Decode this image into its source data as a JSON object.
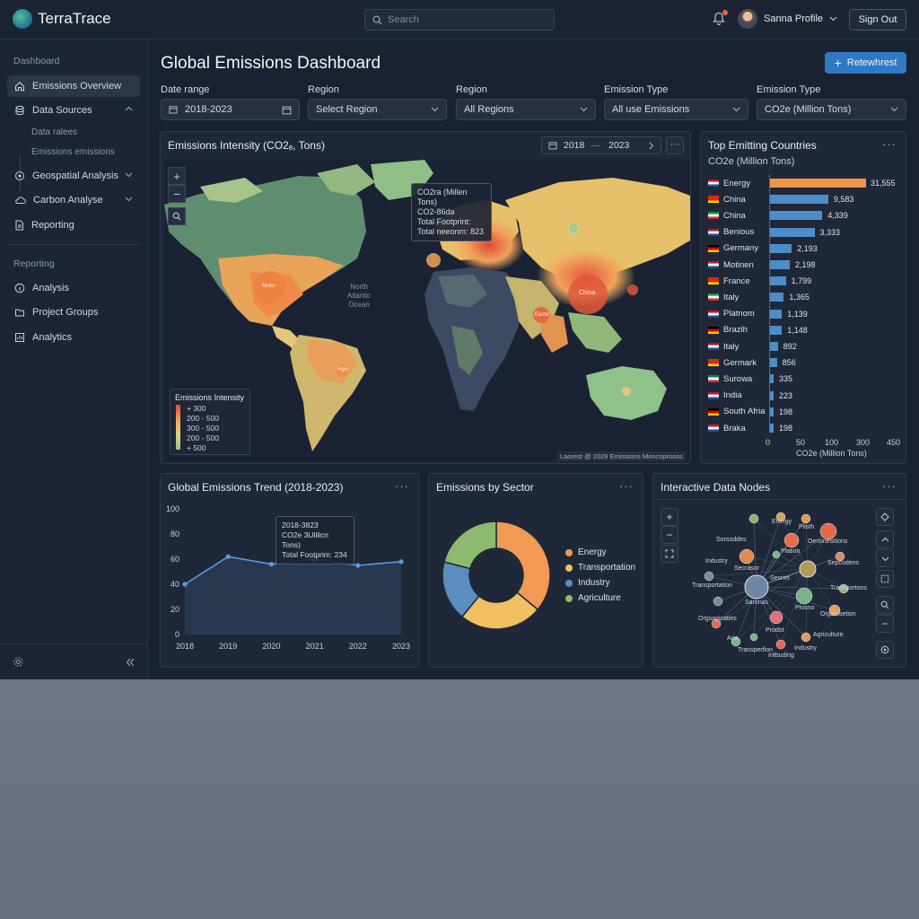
{
  "app": {
    "name": "TerraTrace"
  },
  "topbar": {
    "search_placeholder": "Search",
    "user_name": "Sanna Profile",
    "signout": "Sign Out"
  },
  "sidebar": {
    "section_dashboard": "Dashboard",
    "items": [
      {
        "label": "Emissions Overview",
        "icon": "home-icon"
      },
      {
        "label": "Data Sources",
        "icon": "database-icon"
      },
      {
        "label": "Geospatial Analysis",
        "icon": "map-pin-icon"
      },
      {
        "label": "Carbon Analyse",
        "icon": "cloud-icon"
      },
      {
        "label": "Reporting",
        "icon": "document-icon"
      }
    ],
    "subitems": [
      "Data ralees",
      "Emissions emissions"
    ],
    "section_reporting": "Reporting",
    "items2": [
      {
        "label": "Analysis",
        "icon": "info-icon"
      },
      {
        "label": "Project Groups",
        "icon": "folder-icon"
      },
      {
        "label": "Analytics",
        "icon": "analytics-icon"
      }
    ]
  },
  "main": {
    "title": "Global Emissions Dashboard",
    "refresh_label": "Retewhrest",
    "filters": [
      {
        "label": "Date range",
        "value": "2018-2023"
      },
      {
        "label": "Region",
        "value": "Select Region"
      },
      {
        "label": "Region",
        "value": "All Regions"
      },
      {
        "label": "Emission Type",
        "value": "All use Emissions"
      },
      {
        "label": "Emission Type",
        "value": "CO2e (Million Tons)"
      }
    ]
  },
  "map_panel": {
    "title": "Emissions Intensity (CO2ₑ, Tons)",
    "date_from": "2018",
    "date_sep": "—",
    "date_to": "2023",
    "tooltip": [
      "CO2ra (Millen Tons)",
      "CO2-86da",
      "Total Footprint:",
      "Total neeonm: 823"
    ],
    "ocean_label": [
      "North",
      "Atlantic",
      "Ocean"
    ],
    "bubble_labels": [
      "Moer",
      "China",
      "Easte",
      "Rgis"
    ],
    "legend_title": "Emissions Intensity",
    "legend_rows": [
      "+ 300",
      "200 - 500",
      "300 - 500",
      "200 - 500",
      "+ 500"
    ],
    "credit": "Laorest @ 2029 Emissions Moncoprooss",
    "colors": {
      "high": "#e2483c",
      "mid": "#f0a25a",
      "low": "#e6d37a",
      "min": "#8fc18b"
    }
  },
  "countries_panel": {
    "title": "Top Emitting Countries",
    "subtitle": "CO2e (Million Tons)",
    "xaxis_label": "CO2e (Million Tons)",
    "xticks": [
      "0",
      "50",
      "100",
      "300",
      "450"
    ],
    "rows": [
      {
        "name": "Energy",
        "value": "31,555",
        "pct": 0.97
      },
      {
        "name": "China",
        "value": "9,583",
        "pct": 0.59
      },
      {
        "name": "China",
        "value": "4,339",
        "pct": 0.53
      },
      {
        "name": "Benious",
        "value": "3,333",
        "pct": 0.45
      },
      {
        "name": "Germany",
        "value": "2,193",
        "pct": 0.22
      },
      {
        "name": "Motinen",
        "value": "2,198",
        "pct": 0.2
      },
      {
        "name": "France",
        "value": "1,799",
        "pct": 0.16
      },
      {
        "name": "Italy",
        "value": "1,365",
        "pct": 0.14
      },
      {
        "name": "Platnom",
        "value": "1,139",
        "pct": 0.12
      },
      {
        "name": "Brazih",
        "value": "1,148",
        "pct": 0.12
      },
      {
        "name": "Italy",
        "value": "892",
        "pct": 0.08
      },
      {
        "name": "Germark",
        "value": "856",
        "pct": 0.07
      },
      {
        "name": "Surowa",
        "value": "335",
        "pct": 0.03
      },
      {
        "name": "India",
        "value": "223",
        "pct": 0.02
      },
      {
        "name": "South Afria",
        "value": "198",
        "pct": 0.02
      },
      {
        "name": "Braka",
        "value": "198",
        "pct": 0.02
      }
    ]
  },
  "trend_panel": {
    "title": "Global Emissions Trend (2018-2023)",
    "tooltip": [
      "2018-3823",
      "CO2e 3Ulilicn Tons)",
      "Total Footprim: 234"
    ]
  },
  "sector_panel": {
    "title": "Emissions by Sector"
  },
  "nodes_panel": {
    "title": "Interactive Data Nodes",
    "labels": [
      "Energy",
      "Plisth",
      "Sorsoddes",
      "Oersinesitions",
      "Industry",
      "Plation",
      "Sepcodens",
      "Secrasor",
      "Saronas",
      "Transportation",
      "Transportons",
      "Sesriet",
      "Plosno",
      "Organisetion",
      "Orgsagicaties",
      "Prodot",
      "Agriculture",
      "Aria",
      "Transperfion",
      "Industry",
      "Intbuding"
    ]
  },
  "chart_data": [
    {
      "type": "line",
      "x": [
        "2018",
        "2019",
        "2020",
        "2021",
        "2022",
        "2023"
      ],
      "series": [
        {
          "values": [
            40,
            62,
            56,
            60,
            55,
            58
          ]
        }
      ],
      "ylim": [
        0,
        100
      ],
      "yticks": [
        0,
        20,
        40,
        60,
        80,
        100
      ],
      "grid": false
    },
    {
      "type": "pie",
      "categories": [
        "Energy",
        "Transportation",
        "Industry",
        "Agriculture"
      ],
      "values": [
        36,
        25,
        18,
        21
      ],
      "colors": [
        "#f09a55",
        "#f0c061",
        "#5b8dc0",
        "#8cba6e"
      ],
      "legend": "right"
    },
    {
      "type": "bar",
      "orientation": "horizontal",
      "categories": [
        "Energy",
        "China",
        "China",
        "Benious",
        "Germany",
        "Motinen",
        "France",
        "Italy",
        "Platnom",
        "Brazih",
        "Italy",
        "Germark",
        "Surowa",
        "India",
        "South Afria",
        "Braka"
      ],
      "values": [
        31555,
        9583,
        4339,
        3333,
        2193,
        2198,
        1799,
        1365,
        1139,
        1148,
        892,
        856,
        335,
        223,
        198,
        198
      ],
      "xlabel": "CO2e (Million Tons)"
    }
  ]
}
